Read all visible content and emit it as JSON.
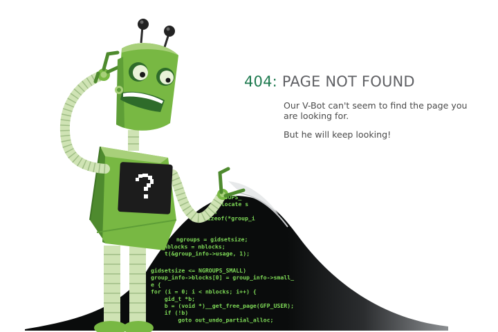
{
  "error": {
    "code": "404:",
    "title": "PAGE NOT FOUND",
    "message": "Our V-Bot can't seem to find the page you are looking for.",
    "submessage": "But he will keep looking!"
  },
  "illustration": {
    "robot_panel_symbol": "?",
    "code_lines": [
      "  NGROUPS_",
      "  allocate s",
      "  ;",
      "  (sizeof(*group_i",
      "",
      "",
      "  ngroups = gidsetsize;",
      ">nblocks = nblocks;",
      "  t(&group_info->usage, 1);",
      "",
      "gidsetsize <= NGROUPS_SMALL)",
      "group_info->blocks[0] = group_info->small_",
      "e {",
      "for (i = 0; i < nblocks; i++) {",
      "    gid_t *b;",
      "    b = (void *)__get_free_page(GFP_USER);",
      "    if (!b)",
      "        goto out_undo_partial_alloc;"
    ]
  },
  "colors": {
    "code_green": "#1e7a4f",
    "title_gray": "#5f6064",
    "robot_green": "#78b843",
    "robot_dark_green": "#4e8a2e",
    "arm_pale_green": "#cfe3b4",
    "terminal_black": "#0a0c0c",
    "code_text_green": "#7ed957"
  },
  "icons": [
    "robot-illustration",
    "question-mark-icon",
    "code-terminal-wave"
  ]
}
